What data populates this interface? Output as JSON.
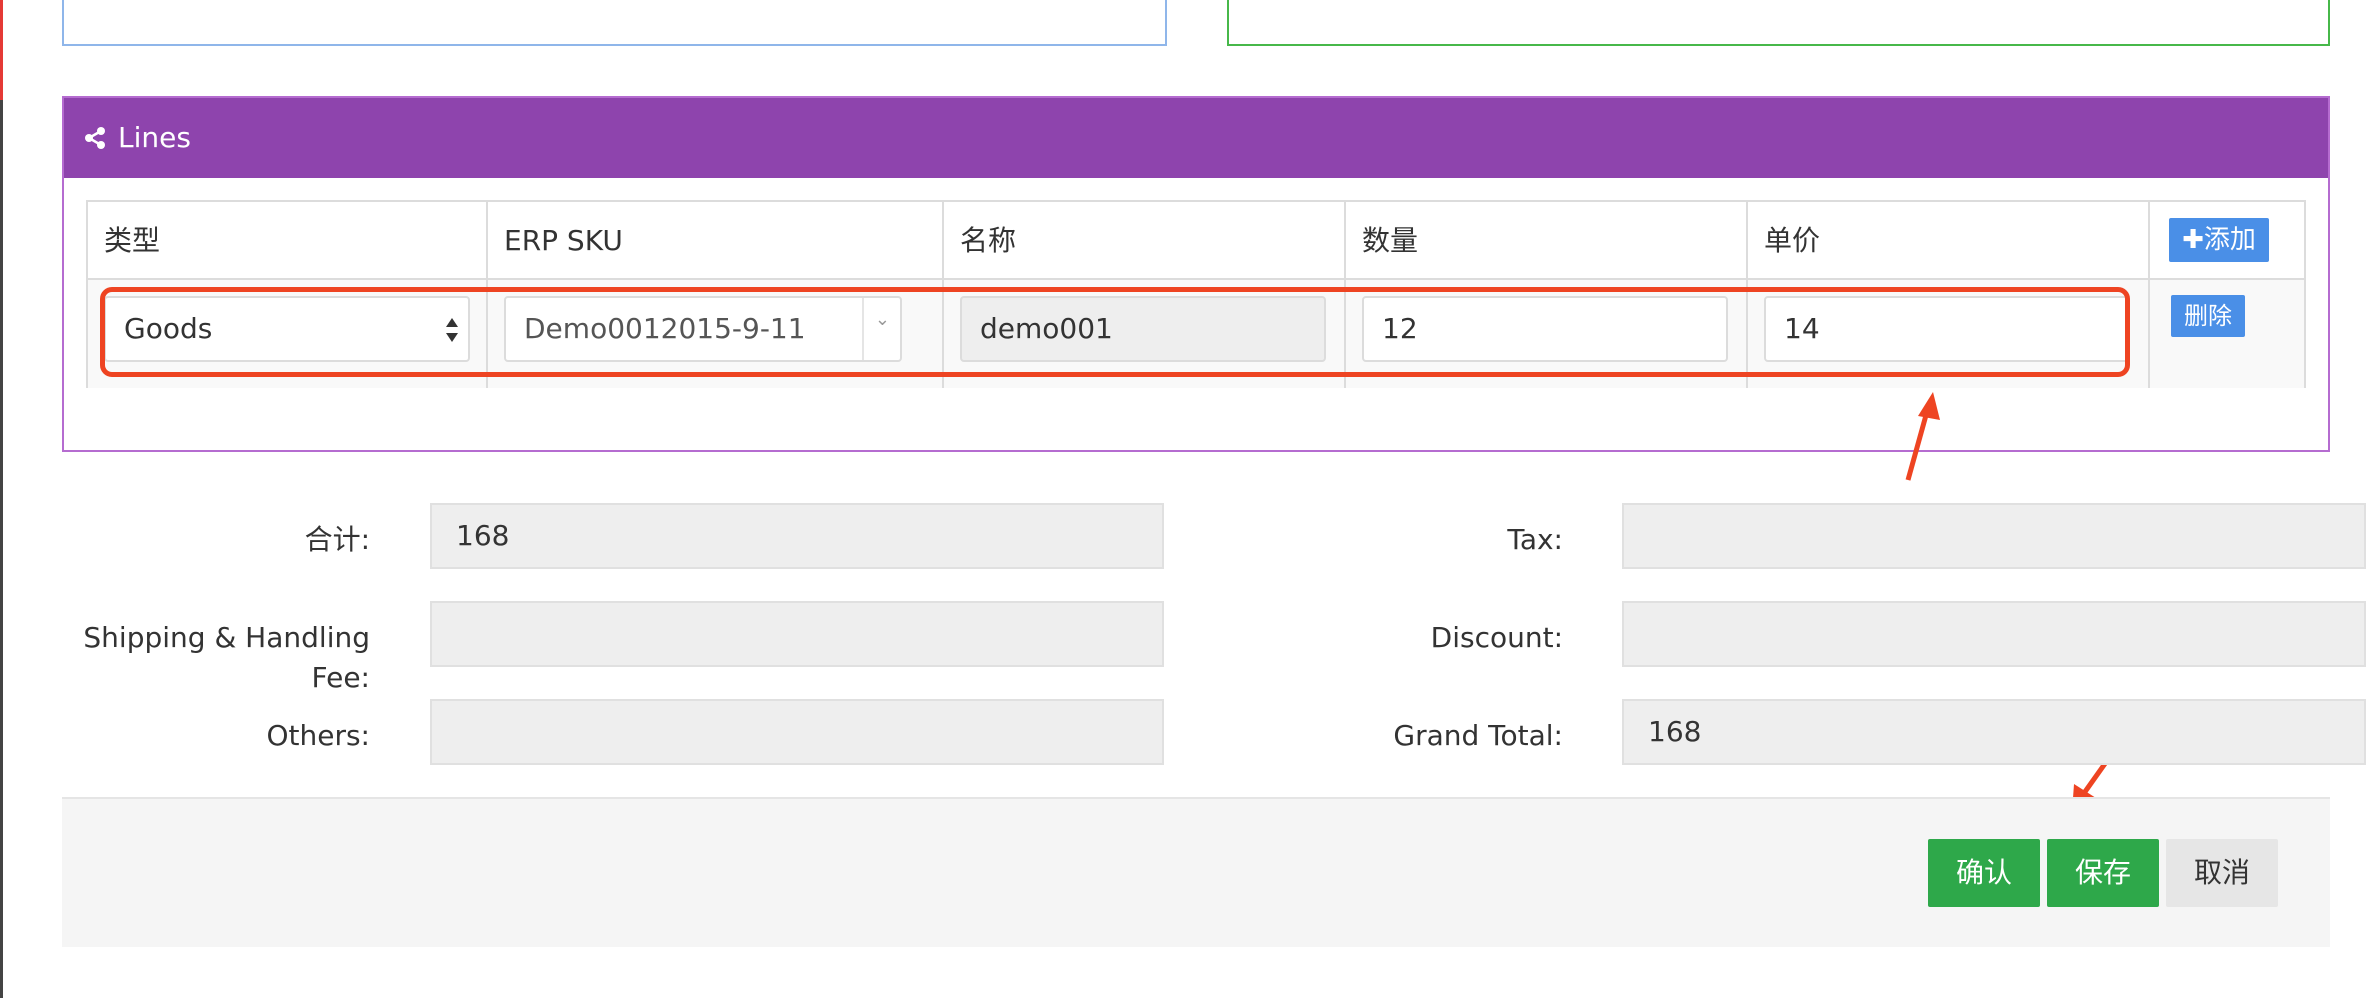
{
  "lines_panel": {
    "title": "Lines",
    "columns": [
      "类型",
      "ERP SKU",
      "名称",
      "数量",
      "单价"
    ],
    "add_label": "添加",
    "row": {
      "type_value": "Goods",
      "sku_value": "Demo0012015-9-11",
      "name_value": "demo001",
      "qty_value": "12",
      "price_value": "14",
      "delete_label": "删除"
    }
  },
  "totals": {
    "subtotal_label": "合计:",
    "subtotal_value": "168",
    "tax_label": "Tax:",
    "tax_value": "",
    "shipping_label": "Shipping & Handling Fee:",
    "shipping_value": "",
    "discount_label": "Discount:",
    "discount_value": "",
    "others_label": "Others:",
    "others_value": "",
    "grand_total_label": "Grand Total:",
    "grand_total_value": "168"
  },
  "footer": {
    "confirm_label": "确认",
    "save_label": "保存",
    "cancel_label": "取消"
  },
  "colors": {
    "header_purple": "#8e44ad",
    "button_blue": "#4a8fe7",
    "button_green": "#2ea84a",
    "annotation_red": "#ee4422"
  },
  "icons": {
    "lines_header": "share-icon",
    "add": "plus-icon",
    "select": "sort-arrows-icon",
    "sku": "chevron-down-icon"
  }
}
